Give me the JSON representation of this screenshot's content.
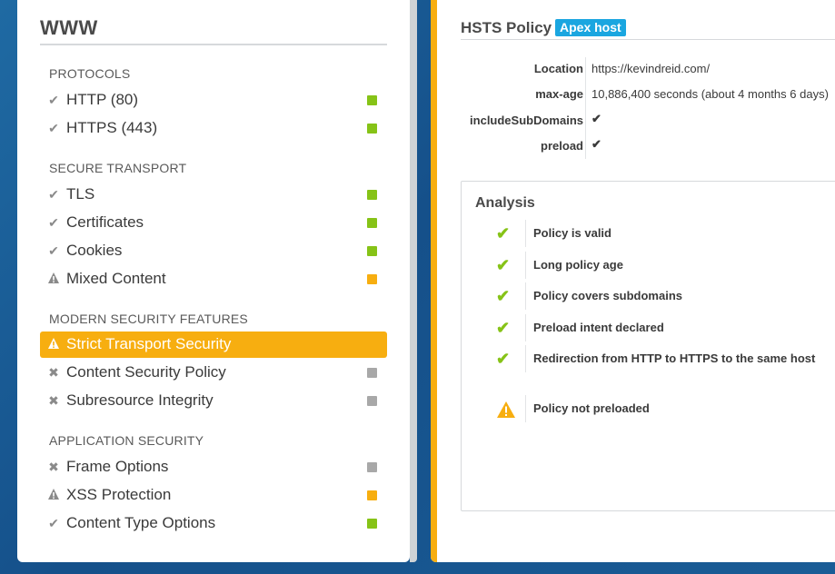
{
  "report": {
    "title": "WWW"
  },
  "sections": [
    {
      "heading": "PROTOCOLS",
      "items": [
        {
          "label": "HTTP (80)",
          "icon": "check-icon",
          "status": "pass"
        },
        {
          "label": "HTTPS (443)",
          "icon": "check-icon",
          "status": "pass"
        }
      ]
    },
    {
      "heading": "SECURE TRANSPORT",
      "items": [
        {
          "label": "TLS",
          "icon": "check-icon",
          "status": "pass"
        },
        {
          "label": "Certificates",
          "icon": "check-icon",
          "status": "pass"
        },
        {
          "label": "Cookies",
          "icon": "check-icon",
          "status": "pass"
        },
        {
          "label": "Mixed Content",
          "icon": "warning-icon",
          "status": "warn"
        }
      ]
    },
    {
      "heading": "MODERN SECURITY FEATURES",
      "items": [
        {
          "label": "Strict Transport Security",
          "icon": "warning-icon",
          "status": "warn",
          "active": true
        },
        {
          "label": "Content Security Policy",
          "icon": "x-icon",
          "status": "none"
        },
        {
          "label": "Subresource Integrity",
          "icon": "x-icon",
          "status": "none"
        }
      ]
    },
    {
      "heading": "APPLICATION SECURITY",
      "items": [
        {
          "label": "Frame Options",
          "icon": "x-icon",
          "status": "none"
        },
        {
          "label": "XSS Protection",
          "icon": "warning-icon",
          "status": "warn"
        },
        {
          "label": "Content Type Options",
          "icon": "check-icon",
          "status": "pass"
        }
      ]
    }
  ],
  "colors": {
    "pass": "#86c317",
    "warn": "#f7ae10",
    "none": "#a8a8a8",
    "accent": "#f7ae10",
    "badge": "#1aa6e0"
  },
  "detail": {
    "title": "HSTS Policy",
    "badge": "Apex host",
    "fields": [
      {
        "key": "Location",
        "value": "https://kevindreid.com/"
      },
      {
        "key": "max-age",
        "value": "10,886,400 seconds (about 4 months 6 days)"
      },
      {
        "key": "includeSubDomains",
        "value": "",
        "icon": "check-icon"
      },
      {
        "key": "preload",
        "value": "",
        "icon": "check-icon"
      }
    ],
    "analysis": {
      "title": "Analysis",
      "items": [
        {
          "text": "Policy is valid",
          "icon": "check-icon"
        },
        {
          "text": "Long policy age",
          "icon": "check-icon"
        },
        {
          "text": "Policy covers subdomains",
          "icon": "check-icon"
        },
        {
          "text": "Preload intent declared",
          "icon": "check-icon"
        },
        {
          "text": "Redirection from HTTP to HTTPS to the same host",
          "icon": "check-icon"
        },
        {
          "text": "Policy not preloaded",
          "icon": "warning-icon"
        }
      ]
    }
  }
}
